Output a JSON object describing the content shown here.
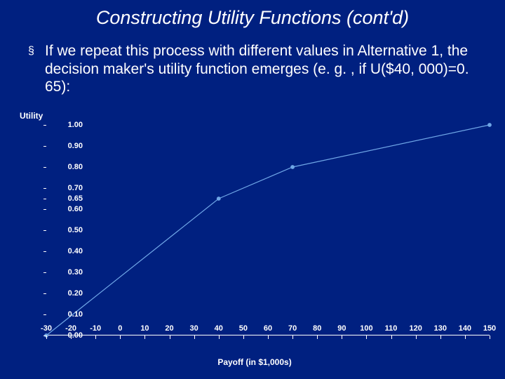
{
  "title": "Constructing Utility Functions (cont'd)",
  "bullet_symbol": "§",
  "body_text": "If we repeat this process with different values in Alternative 1, the decision maker's utility function emerges (e. g. , if U($40, 000)=0. 65):",
  "y_axis_title": "Utility",
  "x_axis_title": "Payoff (in $1,000s)",
  "chart_data": {
    "type": "line",
    "title": "",
    "xlabel": "Payoff (in $1,000s)",
    "ylabel": "Utility",
    "xlim": [
      -30,
      150
    ],
    "ylim": [
      0.0,
      1.0
    ],
    "x_ticks": [
      -30,
      -20,
      -10,
      0,
      10,
      20,
      30,
      40,
      50,
      60,
      70,
      80,
      90,
      100,
      110,
      120,
      130,
      140,
      150
    ],
    "y_ticks": [
      "0.00",
      "0.10",
      "0.20",
      "0.30",
      "0.40",
      "0.50",
      "0.60",
      "0.65",
      "0.70",
      "0.80",
      "0.90",
      "1.00"
    ],
    "y_tick_values": [
      0.0,
      0.1,
      0.2,
      0.3,
      0.4,
      0.5,
      0.6,
      0.65,
      0.7,
      0.8,
      0.9,
      1.0
    ],
    "series": [
      {
        "name": "Utility",
        "x": [
          -30,
          40,
          70,
          150
        ],
        "y": [
          0.0,
          0.65,
          0.8,
          1.0
        ]
      }
    ]
  }
}
